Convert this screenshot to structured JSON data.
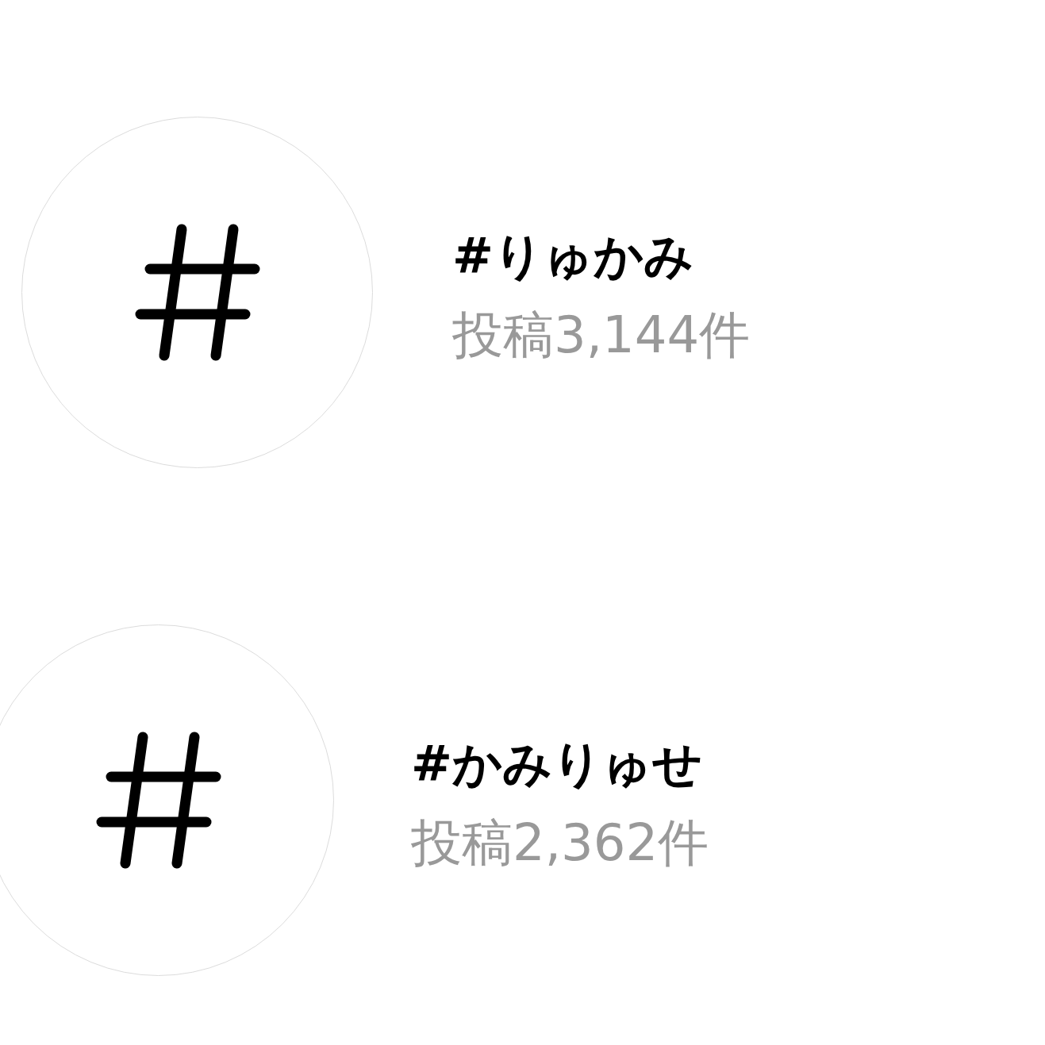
{
  "hashtags": [
    {
      "name": "#りゅかみ",
      "posts": "投稿3,144件"
    },
    {
      "name": "#かみりゅせ",
      "posts": "投稿2,362件"
    }
  ]
}
